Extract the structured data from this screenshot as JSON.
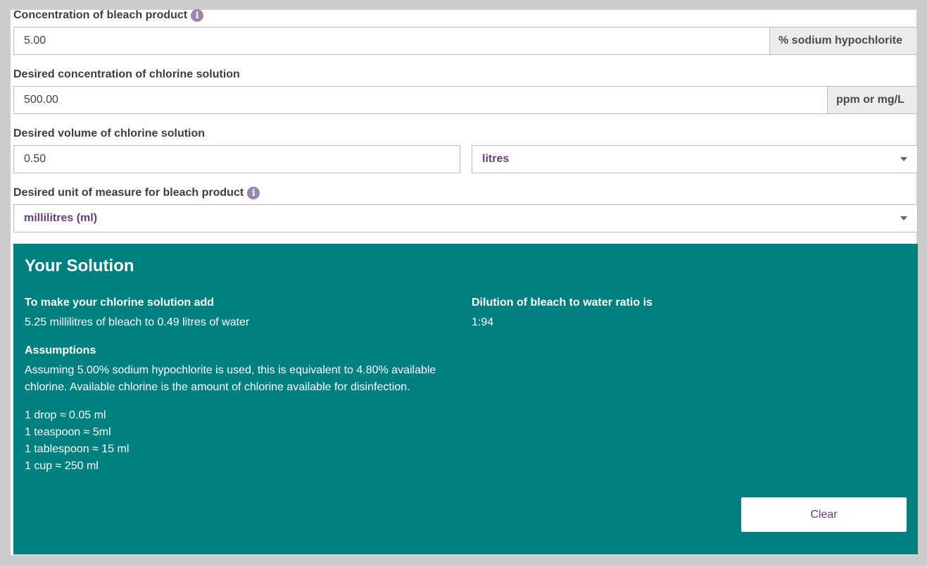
{
  "form": {
    "bleach_concentration": {
      "label": "Concentration of bleach product",
      "info_icon": "i",
      "value": "5.00",
      "unit": "% sodium hypochlorite"
    },
    "desired_concentration": {
      "label": "Desired concentration of chlorine solution",
      "value": "500.00",
      "unit": "ppm or mg/L"
    },
    "desired_volume": {
      "label": "Desired volume of chlorine solution",
      "value": "0.50",
      "unit_selected": "litres"
    },
    "bleach_unit": {
      "label": "Desired unit of measure for bleach product",
      "info_icon": "i",
      "selected": "millilitres (ml)"
    }
  },
  "solution": {
    "title": "Your Solution",
    "add_heading": "To make your chlorine solution add",
    "add_text": "5.25 millilitres of bleach to 0.49 litres of water",
    "ratio_heading": "Dilution of bleach to water ratio is",
    "ratio_text": "1:94",
    "assumptions_heading": "Assumptions",
    "assumptions_line1": "Assuming 5.00% sodium hypochlorite is used, this is equivalent to 4.80% available",
    "assumptions_line2": "chlorine. Available chlorine is the amount of chlorine available for disinfection.",
    "conversions": [
      "1 drop ≈ 0.05 ml",
      "1 teaspoon ≈ 5ml",
      "1 tablespoon ≈ 15 ml",
      "1 cup ≈ 250 ml"
    ],
    "clear_label": "Clear"
  },
  "colors": {
    "solution_bg": "#008080",
    "accent_purple": "#6a3d7a",
    "info_icon": "#9b84ad"
  }
}
